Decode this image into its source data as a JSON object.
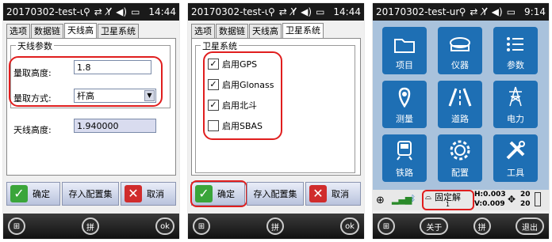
{
  "panel1": {
    "statusbar": {
      "title": "20170302-test-un",
      "time": "14:44"
    },
    "tabs": [
      "选项",
      "数据链",
      "天线高",
      "卫星系统"
    ],
    "active_tab": 2,
    "group_label": "天线参数",
    "height_label": "量取高度:",
    "height_value": "1.8",
    "method_label": "量取方式:",
    "method_value": "杆高",
    "antenna_label": "天线高度:",
    "antenna_value": "1.940000",
    "ok_label": "确定",
    "save_label": "存入配置集",
    "cancel_label": "取消",
    "taskbar_mid": "拼",
    "taskbar_right": "ok"
  },
  "panel2": {
    "statusbar": {
      "title": "20170302-test-un",
      "time": "14:44"
    },
    "tabs": [
      "选项",
      "数据链",
      "天线高",
      "卫星系统"
    ],
    "active_tab": 3,
    "group_label": "卫星系统",
    "checks": [
      {
        "label": "启用GPS",
        "checked": true
      },
      {
        "label": "启用Glonass",
        "checked": true
      },
      {
        "label": "启用北斗",
        "checked": true
      },
      {
        "label": "启用SBAS",
        "checked": false
      }
    ],
    "ok_label": "确定",
    "save_label": "存入配置集",
    "cancel_label": "取消",
    "taskbar_mid": "拼",
    "taskbar_right": "ok"
  },
  "panel3": {
    "statusbar": {
      "title": "20170302-test-unis",
      "time": "9:14"
    },
    "tiles": [
      {
        "label": "项目",
        "icon": "folder-icon"
      },
      {
        "label": "仪器",
        "icon": "instrument-icon"
      },
      {
        "label": "参数",
        "icon": "list-icon"
      },
      {
        "label": "测量",
        "icon": "location-pin-icon"
      },
      {
        "label": "道路",
        "icon": "road-icon"
      },
      {
        "label": "电力",
        "icon": "power-tower-icon"
      },
      {
        "label": "铁路",
        "icon": "train-icon"
      },
      {
        "label": "配置",
        "icon": "gear-icon"
      },
      {
        "label": "工具",
        "icon": "tools-icon"
      }
    ],
    "solution_label": "固定解",
    "solution_sub": "1",
    "h_value": "H:0.003",
    "v_value": "V:0.009",
    "sat_top": "20",
    "sat_bottom": "20",
    "about_label": "关于",
    "exit_label": "退出",
    "taskbar_mid": "拼"
  },
  "colors": {
    "highlight": "#e01e1e",
    "tile": "#1e6fb4",
    "home_bg": "#a9c2dc"
  }
}
